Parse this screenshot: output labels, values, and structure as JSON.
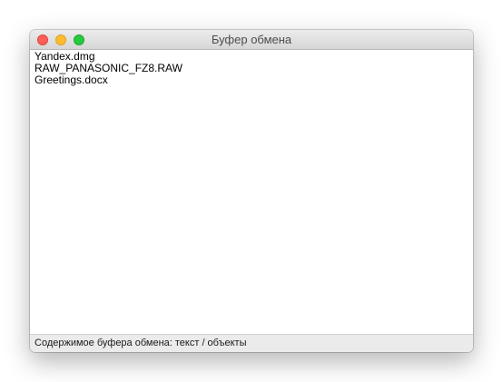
{
  "window": {
    "title": "Буфер обмена"
  },
  "traffic_lights": {
    "close_color": "#fc5f57",
    "minimize_color": "#fdbc2e",
    "zoom_color": "#28c840"
  },
  "clipboard": {
    "items": [
      "Yandex.dmg",
      "RAW_PANASONIC_FZ8.RAW",
      "Greetings.docx"
    ]
  },
  "status": {
    "text": "Содержимое буфера обмена: текст / объекты"
  }
}
